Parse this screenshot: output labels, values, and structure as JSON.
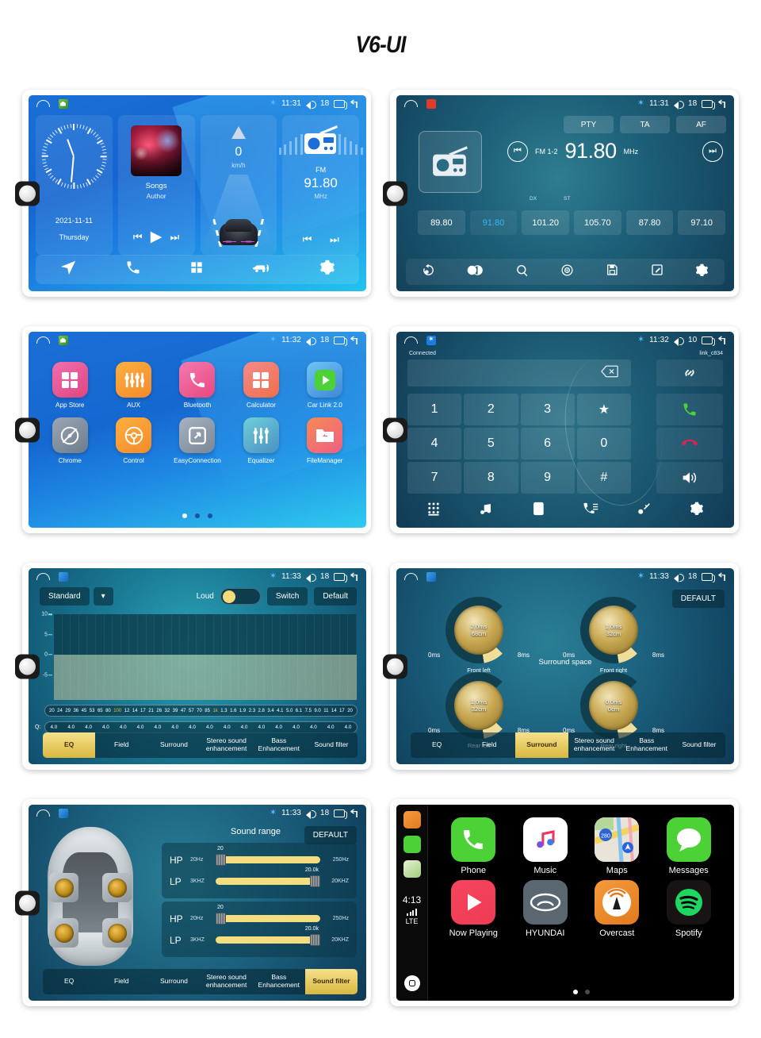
{
  "title": "V6-UI",
  "statusbars": {
    "p1": {
      "time": "11:31",
      "volume": "18"
    },
    "p2": {
      "time": "11:31",
      "volume": "18"
    },
    "p3": {
      "time": "11:32",
      "volume": "18"
    },
    "p4": {
      "time": "11:32",
      "volume": "10"
    },
    "p5": {
      "time": "11:33",
      "volume": "18"
    },
    "p6": {
      "time": "11:33",
      "volume": "18"
    },
    "p7": {
      "time": "11:33",
      "volume": "18"
    }
  },
  "home": {
    "date": "2021-11-11",
    "day": "Thursday",
    "song_title": "Songs",
    "song_artist": "Author",
    "speed": "0",
    "speed_unit": "km/h",
    "radio_band": "FM",
    "radio_freq": "91.80",
    "radio_unit": "MHz"
  },
  "radio": {
    "pty": "PTY",
    "ta": "TA",
    "af": "AF",
    "band": "FM 1-2",
    "frequency": "91.80",
    "unit": "MHz",
    "dx": "DX",
    "st": "ST",
    "presets": [
      "89.80",
      "91.80",
      "101.20",
      "105.70",
      "87.80",
      "97.10"
    ],
    "active_preset_index": 1
  },
  "apps": {
    "items": [
      {
        "label": "App Store",
        "icon": "grid-icon"
      },
      {
        "label": "AUX",
        "icon": "sliders-icon"
      },
      {
        "label": "Bluetooth",
        "icon": "phone-icon"
      },
      {
        "label": "Calculator",
        "icon": "calculator-icon"
      },
      {
        "label": "Car Link 2.0",
        "icon": "play-circle-icon"
      },
      {
        "label": "Chrome",
        "icon": "compass-icon"
      },
      {
        "label": "Control",
        "icon": "steering-wheel-icon"
      },
      {
        "label": "EasyConnection",
        "icon": "screen-mirror-icon"
      },
      {
        "label": "Equalizer",
        "icon": "faders-icon"
      },
      {
        "label": "FileManager",
        "icon": "folder-icon"
      }
    ],
    "page_dots": 3,
    "active_dot": 0
  },
  "dialer": {
    "status": "Connected",
    "device": "link_c834",
    "keys": [
      "1",
      "2",
      "3",
      "★",
      "4",
      "5",
      "6",
      "0",
      "7",
      "8",
      "9",
      "#"
    ]
  },
  "equalizer": {
    "preset": "Standard",
    "loud_label": "Loud",
    "switch_label": "Switch",
    "default_label": "Default",
    "y_axis": [
      "10",
      "5",
      "0",
      "-5"
    ],
    "bands": [
      "20",
      "24",
      "29",
      "36",
      "45",
      "53",
      "65",
      "80",
      "100",
      "12",
      "14",
      "17",
      "21",
      "26",
      "32",
      "39",
      "47",
      "57",
      "70",
      "85",
      "1k",
      "1.3",
      "1.6",
      "1.9",
      "2.3",
      "2.8",
      "3.4",
      "4.1",
      "5.0",
      "6.1",
      "7.5",
      "9.0",
      "11",
      "14",
      "17",
      "20"
    ],
    "highlight_bands": [
      "100",
      "1k"
    ],
    "q_label": "Q:",
    "q_values": [
      "4.0",
      "4.0",
      "4.0",
      "4.0",
      "4.0",
      "4.0",
      "4.0",
      "4.0",
      "4.0",
      "4.0",
      "4.0",
      "4.0",
      "4.0",
      "4.0",
      "4.0",
      "4.0",
      "4.0",
      "4.0"
    ],
    "tabs": [
      "EQ",
      "Field",
      "Surround",
      "Stereo sound enhancement",
      "Bass Enhancement",
      "Sound filter"
    ],
    "active_tab_eq": 0,
    "active_tab_surround": 2,
    "active_tab_filter": 5
  },
  "surround": {
    "title": "Surround space",
    "default_label": "DEFAULT",
    "knobs": [
      {
        "name": "Front left",
        "delay": "2.0ms",
        "distance": "68cm",
        "min": "0ms",
        "max": "8ms"
      },
      {
        "name": "Front right",
        "delay": "1.0ms",
        "distance": "32cm",
        "min": "0ms",
        "max": "8ms"
      },
      {
        "name": "Rear left",
        "delay": "1.0ms",
        "distance": "32cm",
        "min": "0ms",
        "max": "8ms"
      },
      {
        "name": "Rear right",
        "delay": "0.0ms",
        "distance": "0cm",
        "min": "0ms",
        "max": "8ms"
      }
    ]
  },
  "soundfilter": {
    "title": "Sound range",
    "default_label": "DEFAULT",
    "groups": [
      {
        "rows": [
          {
            "tag": "HP",
            "low": "20Hz",
            "value": "20",
            "high": "250Hz",
            "grip": "left"
          },
          {
            "tag": "LP",
            "low": "3KHZ",
            "value": "20.0k",
            "high": "20KHZ",
            "grip": "right"
          }
        ]
      },
      {
        "rows": [
          {
            "tag": "HP",
            "low": "20Hz",
            "value": "20",
            "high": "250Hz",
            "grip": "left"
          },
          {
            "tag": "LP",
            "low": "3KHZ",
            "value": "20.0k",
            "high": "20KHZ",
            "grip": "right"
          }
        ]
      }
    ]
  },
  "carplay": {
    "time": "4:13",
    "network": "LTE",
    "apps": [
      {
        "label": "Phone",
        "icon": "phone-icon"
      },
      {
        "label": "Music",
        "icon": "music-note-icon"
      },
      {
        "label": "Maps",
        "icon": "maps-icon"
      },
      {
        "label": "Messages",
        "icon": "message-bubble-icon"
      },
      {
        "label": "Now Playing",
        "icon": "play-icon"
      },
      {
        "label": "HYUNDAI",
        "icon": "hyundai-logo-icon"
      },
      {
        "label": "Overcast",
        "icon": "overcast-icon"
      },
      {
        "label": "Spotify",
        "icon": "spotify-icon"
      }
    ],
    "page_dots": 2,
    "active_dot": 0
  }
}
